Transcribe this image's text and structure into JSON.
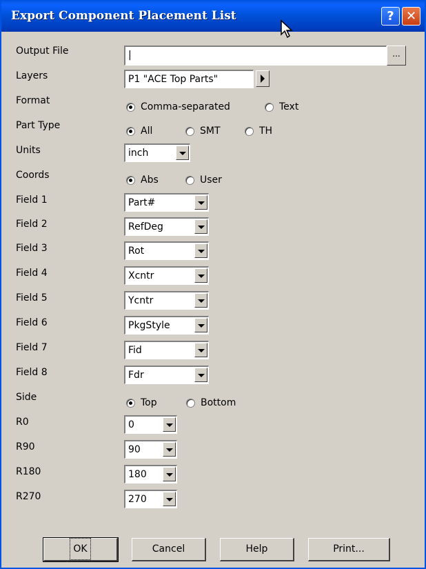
{
  "window": {
    "title": "Export Component Placement List",
    "help_label": "?",
    "close_label": "✕"
  },
  "fields": {
    "output_file": {
      "label": "Output File",
      "value": "|",
      "browse_label": "..."
    },
    "layers": {
      "label": "Layers",
      "value": "P1 \"ACE Top Parts\""
    },
    "format": {
      "label": "Format",
      "options": [
        "Comma-separated",
        "Text"
      ],
      "selected": "Comma-separated"
    },
    "part_type": {
      "label": "Part Type",
      "options": [
        "All",
        "SMT",
        "TH"
      ],
      "selected": "All"
    },
    "units": {
      "label": "Units",
      "value": "inch"
    },
    "coords": {
      "label": "Coords",
      "options": [
        "Abs",
        "User"
      ],
      "selected": "Abs"
    },
    "field_1": {
      "label": "Field 1",
      "value": "Part#"
    },
    "field_2": {
      "label": "Field 2",
      "value": "RefDeg"
    },
    "field_3": {
      "label": "Field 3",
      "value": "Rot"
    },
    "field_4": {
      "label": "Field 4",
      "value": "Xcntr"
    },
    "field_5": {
      "label": "Field 5",
      "value": "Ycntr"
    },
    "field_6": {
      "label": "Field 6",
      "value": "PkgStyle"
    },
    "field_7": {
      "label": "Field 7",
      "value": "Fid"
    },
    "field_8": {
      "label": "Field 8",
      "value": "Fdr"
    },
    "side": {
      "label": "Side",
      "options": [
        "Top",
        "Bottom"
      ],
      "selected": "Top"
    },
    "r0": {
      "label": "R0",
      "value": "0"
    },
    "r90": {
      "label": "R90",
      "value": "90"
    },
    "r180": {
      "label": "R180",
      "value": "180"
    },
    "r270": {
      "label": "R270",
      "value": "270"
    }
  },
  "buttons": {
    "ok": "OK",
    "cancel": "Cancel",
    "help": "Help",
    "print": "Print..."
  },
  "colors": {
    "titlebar": "#0052d8",
    "face": "#d4d0c8"
  }
}
